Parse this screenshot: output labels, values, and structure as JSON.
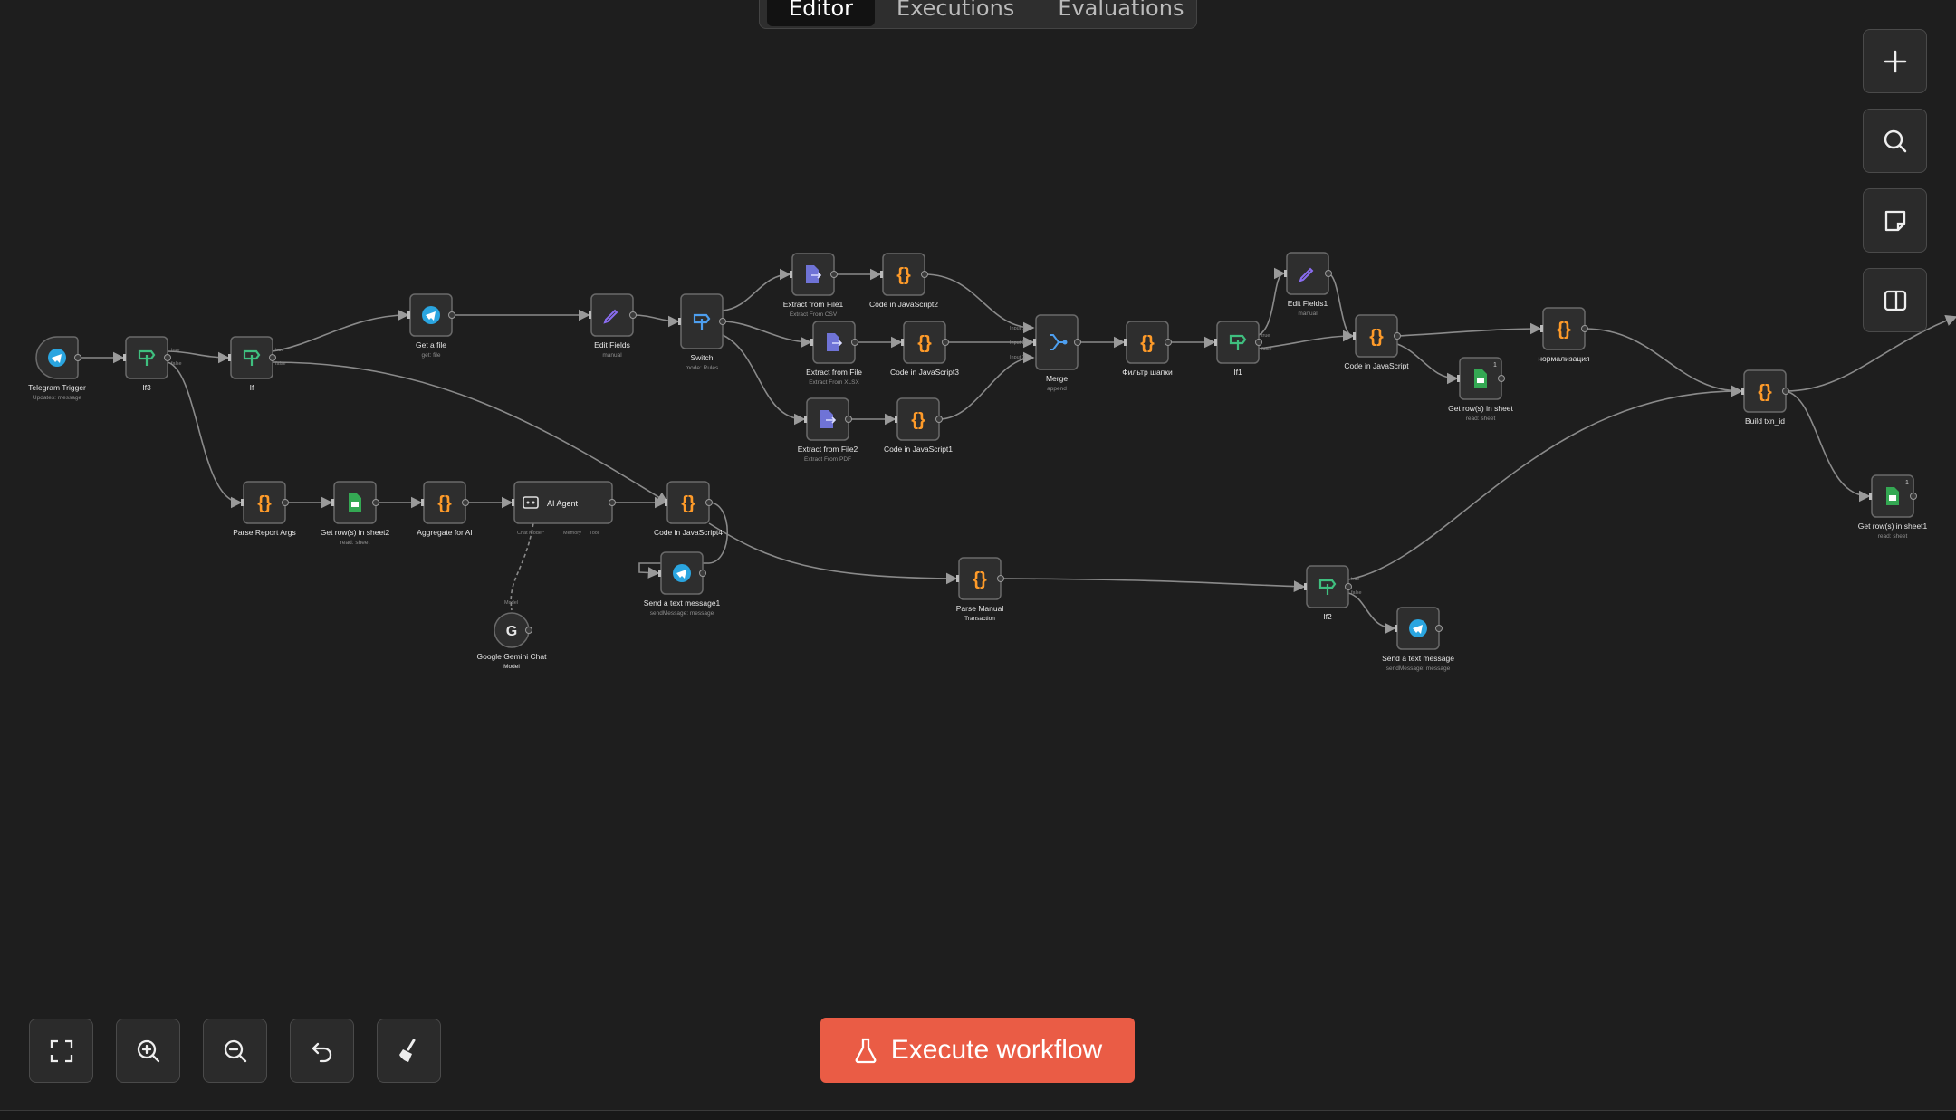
{
  "tabs": [
    {
      "label": "Editor",
      "active": true
    },
    {
      "label": "Executions"
    },
    {
      "label": "Evaluations"
    }
  ],
  "execute_label": "Execute workflow",
  "colors": {
    "bg": "#1e1e1e",
    "node": "#2e2e2e",
    "border": "#6a6a6a",
    "accent": "#ea5c45",
    "code": "#ff9b29",
    "telegram": "#2aa5e0",
    "if": "#3fbf7f",
    "sheets": "#34a853",
    "edit": "#8a6cf0",
    "extract": "#6f73d6",
    "switch": "#4d9ff0"
  },
  "nodes": [
    {
      "id": "telegram-trigger",
      "icon": "telegram",
      "label": "Telegram Trigger",
      "sub": "Updates: message"
    },
    {
      "id": "if3",
      "icon": "if",
      "label": "If3",
      "sub": ""
    },
    {
      "id": "if",
      "icon": "if",
      "label": "If",
      "sub": ""
    },
    {
      "id": "get-file",
      "icon": "telegram",
      "label": "Get a file",
      "sub": "get: file"
    },
    {
      "id": "edit-fields",
      "icon": "edit",
      "label": "Edit Fields",
      "sub": "manual"
    },
    {
      "id": "switch",
      "icon": "switch",
      "label": "Switch",
      "sub": "mode: Rules"
    },
    {
      "id": "extract1",
      "icon": "extract",
      "label": "Extract from File1",
      "sub": "Extract From CSV"
    },
    {
      "id": "code2",
      "icon": "code",
      "label": "Code in JavaScript2",
      "sub": ""
    },
    {
      "id": "extract",
      "icon": "extract",
      "label": "Extract from File",
      "sub": "Extract From XLSX"
    },
    {
      "id": "code3",
      "icon": "code",
      "label": "Code in JavaScript3",
      "sub": ""
    },
    {
      "id": "extract2",
      "icon": "extract",
      "label": "Extract from File2",
      "sub": "Extract From PDF"
    },
    {
      "id": "code1",
      "icon": "code",
      "label": "Code in JavaScript1",
      "sub": ""
    },
    {
      "id": "merge",
      "icon": "merge",
      "label": "Merge",
      "sub": "append"
    },
    {
      "id": "filter",
      "icon": "code",
      "label": "Фильтр шапки",
      "sub": ""
    },
    {
      "id": "if1",
      "icon": "if",
      "label": "If1",
      "sub": ""
    },
    {
      "id": "edit-fields1",
      "icon": "edit",
      "label": "Edit Fields1",
      "sub": "manual"
    },
    {
      "id": "code",
      "icon": "code",
      "label": "Code in JavaScript",
      "sub": ""
    },
    {
      "id": "get-rows-sheet",
      "icon": "sheets",
      "label": "Get row(s) in sheet",
      "sub": "read: sheet"
    },
    {
      "id": "normalize",
      "icon": "code",
      "label": "нормализация",
      "sub": ""
    },
    {
      "id": "build-txn",
      "icon": "code",
      "label": "Build txn_id",
      "sub": ""
    },
    {
      "id": "get-rows-sheet1",
      "icon": "sheets",
      "label": "Get row(s) in sheet1",
      "sub": "read: sheet"
    },
    {
      "id": "parse-report",
      "icon": "code",
      "label": "Parse Report Args",
      "sub": ""
    },
    {
      "id": "get-rows-sheet2",
      "icon": "sheets",
      "label": "Get row(s) in sheet2",
      "sub": "read: sheet"
    },
    {
      "id": "aggregate",
      "icon": "code",
      "label": "Aggregate for AI",
      "sub": ""
    },
    {
      "id": "ai-agent",
      "icon": "robot",
      "label": "AI Agent",
      "sub": ""
    },
    {
      "id": "code4",
      "icon": "code",
      "label": "Code in JavaScript4",
      "sub": ""
    },
    {
      "id": "send-msg1",
      "icon": "telegram",
      "label": "Send a text message1",
      "sub": "sendMessage: message"
    },
    {
      "id": "gemini",
      "icon": "google",
      "label": "Google Gemini Chat",
      "sub": "Model"
    },
    {
      "id": "parse-manual",
      "icon": "code",
      "label": "Parse Manual",
      "sub": "Transaction"
    },
    {
      "id": "if2",
      "icon": "if",
      "label": "If2",
      "sub": ""
    },
    {
      "id": "send-msg",
      "icon": "telegram",
      "label": "Send a text message",
      "sub": "sendMessage: message"
    }
  ],
  "ports": {
    "chat_model": "Chat Model*",
    "memory": "Memory",
    "tool": "Tool",
    "model": "Model",
    "input1": "Input 1",
    "input2": "Input 2",
    "input3": "Input 3",
    "true": "true",
    "false": "false"
  },
  "badges": {
    "count": "1"
  }
}
